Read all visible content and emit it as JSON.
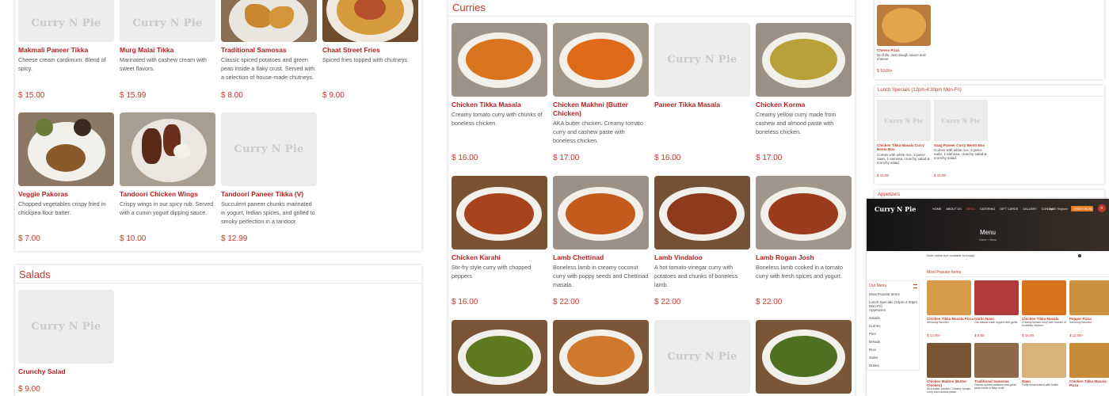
{
  "placeholder_text": "Curry N Pie",
  "appetizers": {
    "row1": [
      {
        "name": "Makmali Paneer Tikka",
        "desc": "Cheese cream cardimum. Blend of spicy.",
        "price": "$ 15.00",
        "image": "placeholder"
      },
      {
        "name": "Murg Malai Tikka",
        "desc": "Marinated with cashew cream with sweet flavors.",
        "price": "$ 15.99",
        "image": "placeholder"
      },
      {
        "name": "Traditional Samosas",
        "desc": "Classic spiced potatoes and green peas inside a flaky crust. Served with a selection of house-made chutneys.",
        "price": "$ 8.00",
        "image": "samosa"
      },
      {
        "name": "Chaat Street Fries",
        "desc": "Spiced fries topped with chutneys",
        "price": "$ 9.00",
        "image": "fries"
      }
    ],
    "row2": [
      {
        "name": "Veggie Pakoras",
        "desc": "Chopped vegetables crispy fried in chickpea flour batter.",
        "price": "$ 7.00",
        "image": "pakora"
      },
      {
        "name": "Tandoori Chicken Wings",
        "desc": "Crispy wings in our spicy rub. Served with a cumin yogurt dipping sauce.",
        "price": "$ 10.00",
        "image": "wings"
      },
      {
        "name": "Tandoori Paneer Tikka (V)",
        "desc": "Succulent paneer chunks marinated in yogurt, Indian spices, and grilled to smoky perfection in a tandoor.",
        "price": "$ 12.99",
        "image": "placeholder"
      }
    ]
  },
  "salads": {
    "title": "Salads",
    "items": [
      {
        "name": "Crunchy Salad",
        "desc": "",
        "price": "$ 9.00",
        "image": "placeholder"
      }
    ]
  },
  "curries": {
    "title": "Curries",
    "row1": [
      {
        "name": "Chicken Tikka Masala",
        "desc": "Creamy tomato curry with chunks of boneless chicken.",
        "price": "$ 16.00",
        "image": "orange-curry"
      },
      {
        "name": "Chicken Makhni (Butter Chicken)",
        "desc": "AKA butter chicken. Creamy tomato curry and cashew paste with boneless chicken.",
        "price": "$ 17.00",
        "image": "orange-curry"
      },
      {
        "name": "Paneer Tikka Masala",
        "desc": "",
        "price": "$ 16.00",
        "image": "placeholder"
      },
      {
        "name": "Chicken Korma",
        "desc": "Creamy yellow curry made from cashew and almond paste with boneless chicken.",
        "price": "$ 17.00",
        "image": "yellow-curry"
      }
    ],
    "row2": [
      {
        "name": "Chicken Karahi",
        "desc": "Stir-fry style curry with chopped peppers",
        "price": "$ 16.00",
        "image": "red-curry"
      },
      {
        "name": "Lamb Chettinad",
        "desc": "Boneless lamb in creamy coconut curry with poppy seeds and Chettinad masala.",
        "price": "$ 22.00",
        "image": "orange-curry"
      },
      {
        "name": "Lamb Vindaloo",
        "desc": "A hot tomato-vinegar curry with potatoes and chunks of boneless lamb.",
        "price": "$ 22.00",
        "image": "brown-curry"
      },
      {
        "name": "Lamb Rogan Josh",
        "desc": "Boneless lamb cooked in a tomato curry with fresh spices and yogurt.",
        "price": "$ 22.00",
        "image": "red-curry"
      }
    ],
    "row3": [
      {
        "image": "green-curry"
      },
      {
        "image": "orange-curry"
      },
      {
        "image": "placeholder"
      },
      {
        "image": "green-curry"
      }
    ]
  },
  "right_panel": {
    "pizza": {
      "name": "Cheese Pizza",
      "desc": "No frills. Just dough sauce and cheese",
      "price": "$ 10.00+"
    },
    "lunch": {
      "title": "Lunch Specials (12pm-4:30pm Mon-Fri)",
      "items": [
        {
          "name": "Chicken Tikka Masala Curry Bento Box",
          "desc": "Comes with white rice, 2 piece naan, 1 samosa, crunchy salad & crunchy salad.",
          "price": "$ 15.00"
        },
        {
          "name": "Saag Paneer Curry Bento Box",
          "desc": "Comes with white rice, 2 piece naan, 1 samosa, crunchy salad & crunchy salad.",
          "price": "$ 15.00"
        }
      ]
    },
    "appetizers_label": "Appetizers"
  },
  "overlay_site": {
    "logo": "Curry N Pie",
    "nav": [
      "HOME",
      "ABOUT US",
      "MENU",
      "CATERING",
      "GIFT CARDS",
      "GALLERY",
      "CONTACT"
    ],
    "login": "Login / Register",
    "order_button": "ORDER ONLINE",
    "cart_count": "0",
    "hero_title": "Menu",
    "breadcrumb": "Home > Menu",
    "notice": "Order online isn't available for today!",
    "sidebar_title": "Our Menu",
    "sidebar_items": [
      "Most Popular Items",
      "Lunch Specials (12pm-4:30pm Mon-Fri)",
      "Appetizers",
      "Salads",
      "Curries",
      "Pies",
      "Breads",
      "Rice",
      "Sides",
      "Drinks"
    ],
    "popular_title": "Most Popular Items",
    "popular": [
      {
        "name": "Chicken Tikka Masala Pizza",
        "desc": "Seriously flavorful.",
        "price": "$ 12.00+"
      },
      {
        "name": "Garlic Naan",
        "desc": "Our classic naan topped with garlic.",
        "price": "$ 3.50"
      },
      {
        "name": "Chicken Tikka Masala",
        "desc": "Creamy tomato curry with chunks of boneless chicken.",
        "price": "$ 16.00"
      },
      {
        "name": "Pepper Pizza",
        "desc": "Seriously flavorful.",
        "price": "$ 12.00+"
      },
      {
        "name": "Chicken Makhni (Butter Chicken)",
        "desc": "AKA butter chicken. Creamy tomato curry and cashew paste.",
        "price": "$ 17.00"
      },
      {
        "name": "Traditional Samosas",
        "desc": "Classic spiced potatoes and green peas inside a flaky crust.",
        "price": "$ 8.00"
      },
      {
        "name": "Naan",
        "desc": "Fluffy bread baked with butter.",
        "price": "$ 3.00"
      },
      {
        "name": "Chicken Tikka Masala Pizza",
        "desc": "",
        "price": "$ 12.00+"
      }
    ]
  },
  "colors": {
    "accent": "#c0392b",
    "placeholder_bg": "#ececec",
    "dark": "#1f1f1f"
  }
}
